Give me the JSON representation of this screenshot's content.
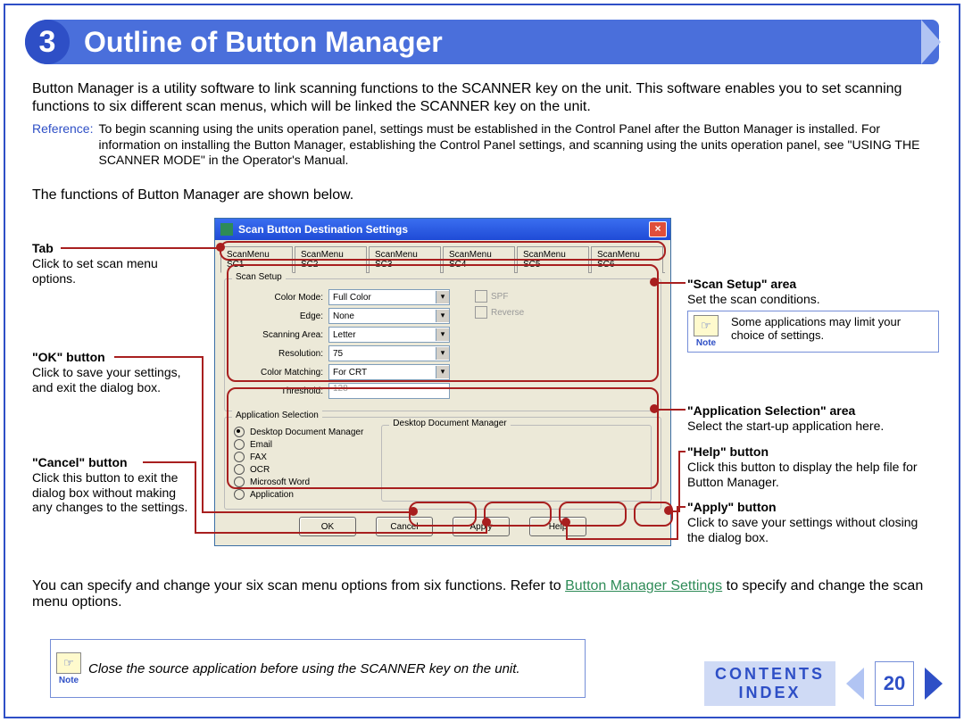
{
  "header": {
    "number": "3",
    "title": "Outline of Button Manager"
  },
  "intro": "Button Manager is a utility software to link scanning functions to the SCANNER key on the unit. This software enables you to set scanning functions to six different scan menus, which will be linked the SCANNER key on the unit.",
  "ref_label": "Reference:",
  "ref_text": "To begin scanning using the units operation panel, settings must be established in the Control Panel after the Button Manager is installed. For information on installing the Button Manager, establishing the Control Panel settings, and scanning using the units operation panel, see \"USING THE SCANNER MODE\" in the Operator's Manual.",
  "functions_text": "The functions of Button Manager are shown below.",
  "callouts": {
    "tab_title": "Tab",
    "tab_desc": "Click to set scan menu options.",
    "ok_title": "\"OK\" button",
    "ok_desc": "Click to save your settings, and exit the dialog box.",
    "cancel_title": "\"Cancel\" button",
    "cancel_desc": "Click this button to exit the dialog box without making any changes to the settings.",
    "scan_title": "\"Scan Setup\" area",
    "scan_desc": "Set the scan conditions.",
    "smallnote": "Some applications may limit your choice of settings.",
    "app_title": "\"Application Selection\" area",
    "app_desc": "Select the start-up application here.",
    "help_title": "\"Help\" button",
    "help_desc": "Click this button to display the help file for Button Manager.",
    "apply_title": "\"Apply\" button",
    "apply_desc": "Click to save your settings without closing the dialog box."
  },
  "dialog": {
    "title": "Scan Button Destination Settings",
    "tabs": [
      "ScanMenu SC1",
      "ScanMenu SC2",
      "ScanMenu SC3",
      "ScanMenu SC4",
      "ScanMenu SC5",
      "ScanMenu SC6"
    ],
    "scan_legend": "Scan Setup",
    "rows": {
      "color_mode_l": "Color Mode:",
      "color_mode_v": "Full Color",
      "edge_l": "Edge:",
      "edge_v": "None",
      "area_l": "Scanning Area:",
      "area_v": "Letter",
      "res_l": "Resolution:",
      "res_v": "75",
      "cm_l": "Color Matching:",
      "cm_v": "For CRT",
      "th_l": "Threshold:",
      "th_v": "128"
    },
    "checks": {
      "spf": "SPF",
      "reverse": "Reverse"
    },
    "appsel_legend": "Application Selection",
    "radios": [
      "Desktop Document Manager",
      "Email",
      "FAX",
      "OCR",
      "Microsoft Word",
      "Application"
    ],
    "preview_legend": "Desktop Document Manager",
    "buttons": {
      "ok": "OK",
      "cancel": "Cancel",
      "apply": "Apply",
      "help": "Help"
    }
  },
  "bottom_para1": "You can specify and change your six scan menu options from six functions. Refer to ",
  "bottom_link": "Button Manager Settings",
  "bottom_para2": " to specify and change the scan menu options.",
  "big_note": "Close the source application before using the SCANNER key on the unit.",
  "note_label": "Note",
  "footer": {
    "contents": "CONTENTS",
    "index": "INDEX",
    "page": "20"
  }
}
